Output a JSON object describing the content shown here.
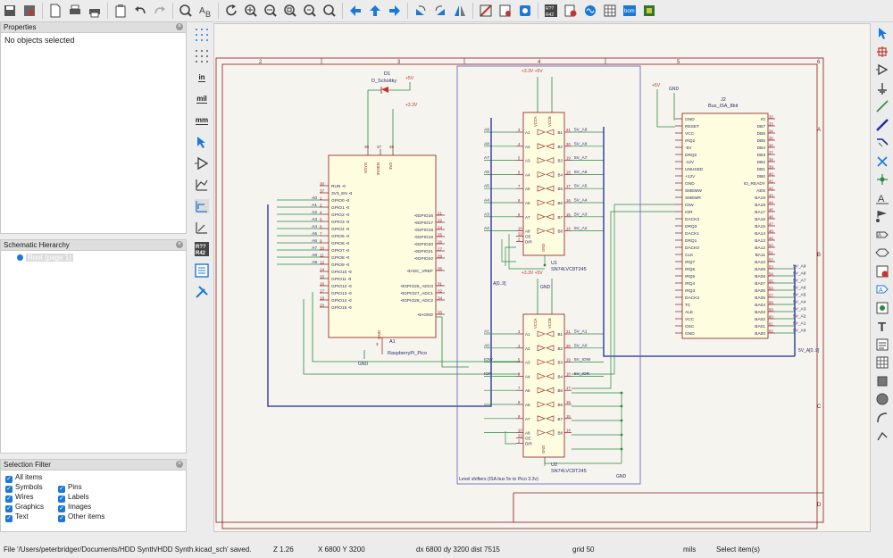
{
  "toolbar": {
    "icons": [
      "save-icon",
      "page-settings-icon",
      "new-icon",
      "print-icon",
      "plot-icon",
      "paste-icon",
      "undo-icon",
      "redo-icon",
      "find-icon",
      "find-replace-icon",
      "refresh-icon",
      "zoom-in-icon",
      "zoom-out-icon",
      "zoom-fit-icon",
      "zoom-selection-icon",
      "zoom-tool-icon",
      "navigate-back-icon",
      "navigate-up-icon",
      "navigate-forward-icon",
      "rotate-ccw-icon",
      "rotate-cw-icon",
      "mirror-icon",
      "erc-icon",
      "symbol-editor-icon",
      "symbol-browser-icon",
      "annotate-icon",
      "erc-check-icon",
      "simulator-icon",
      "field-table-icon",
      "bom-icon",
      "pcb-icon"
    ],
    "annotate_label": "R?? R42",
    "bom_label": "bom"
  },
  "properties_panel": {
    "title": "Properties",
    "empty_text": "No objects selected"
  },
  "hierarchy_panel": {
    "title": "Schematic Hierarchy",
    "root_item": "Root (page 1)"
  },
  "selection_filter": {
    "title": "Selection Filter",
    "items": [
      {
        "label": "All items",
        "checked": true
      },
      {
        "label": "Symbols",
        "checked": true
      },
      {
        "label": "Pins",
        "checked": true
      },
      {
        "label": "Wires",
        "checked": true
      },
      {
        "label": "Labels",
        "checked": true
      },
      {
        "label": "Graphics",
        "checked": true
      },
      {
        "label": "Images",
        "checked": true
      },
      {
        "label": "Text",
        "checked": true
      },
      {
        "label": "Other items",
        "checked": true
      }
    ]
  },
  "left_tools": {
    "units_in": "in",
    "units_mil": "mil",
    "units_mm": "mm",
    "annotate_label": "R?? R42"
  },
  "schematic": {
    "border_numbers": [
      "2",
      "3",
      "4",
      "5",
      "6"
    ],
    "border_letters": [
      "A",
      "B",
      "C",
      "D"
    ],
    "diode": {
      "ref": "D1",
      "value": "D_Schottky",
      "net": "+5V"
    },
    "pico": {
      "ref": "A1",
      "value": "RaspberryPi_Pico",
      "top_net": "+3.3V",
      "gnd": "GND",
      "top_pins": [
        "VSYS",
        "3V3EN",
        "3V3"
      ],
      "top_pin_nums": [
        "39",
        "37",
        "36"
      ],
      "left_pins": [
        "RUN",
        "3V3_EN",
        "GPIO0",
        "GPIO1",
        "GPIO2",
        "GPIO3",
        "GPIO4",
        "GPIO5",
        "GPIO6",
        "GPIO7",
        "GPIO8",
        "GPIO9",
        "GPIO10",
        "GPIO11",
        "GPIO12",
        "GPIO13",
        "GPIO14",
        "GPIO15"
      ],
      "left_nums": [
        "30",
        "37",
        "1",
        "2",
        "4",
        "5",
        "6",
        "7",
        "9",
        "10",
        "11",
        "12",
        "14",
        "15",
        "16",
        "17",
        "19",
        "20"
      ],
      "left_labels": [
        "",
        "",
        "A0",
        "A1",
        "A2",
        "A3",
        "A4",
        "A5",
        "A6",
        "A7",
        "A8",
        "A9",
        "",
        "",
        "",
        "",
        "",
        ""
      ],
      "right_pins": [
        "GPIO16",
        "GPIO17",
        "GPIO18",
        "GPIO19",
        "GPIO20",
        "GPIO21",
        "GPIO22",
        "ADC_VREF",
        "GPIO26_ADC0",
        "GPIO27_ADC1",
        "GPIO28_ADC2",
        "AGND"
      ],
      "right_nums": [
        "21",
        "22",
        "24",
        "25",
        "26",
        "27",
        "29",
        "35",
        "31",
        "32",
        "34",
        "33"
      ],
      "bottom_pin": "GND",
      "bottom_num": "3"
    },
    "u1": {
      "ref": "U1",
      "value": "SN74LVC8T245",
      "top_label": "+3.3V +5V",
      "top_pins": [
        "VCCA",
        "VCCB"
      ],
      "a_pins": [
        "A1",
        "A2",
        "A3",
        "A4",
        "A5",
        "A6",
        "A7",
        "A8",
        "OE",
        "DIR"
      ],
      "b_pins": [
        "B1",
        "B2",
        "B3",
        "B4",
        "B5",
        "B6",
        "B7",
        "B8"
      ],
      "left_nums": [
        "3",
        "4",
        "5",
        "6",
        "7",
        "8",
        "9",
        "10",
        "22",
        "2"
      ],
      "right_nums": [
        "21",
        "20",
        "19",
        "18",
        "17",
        "16",
        "15",
        "14"
      ],
      "in_labels": [
        "A9",
        "A8",
        "A7",
        "A6",
        "A5",
        "A4",
        "A3",
        "A2"
      ],
      "out_labels": [
        "5V_A9",
        "5V_A8",
        "5V_A7",
        "5V_A6",
        "5V_A5",
        "5V_A4",
        "5V_A3",
        "5V_A2"
      ],
      "gnd": "GND",
      "bus_label": "A[0..9]"
    },
    "u2": {
      "ref": "U2",
      "value": "SN74LVC8T245",
      "top_label": "+3.3V +5V",
      "top_pins": [
        "VCCA",
        "VCCB"
      ],
      "a_pins": [
        "A1",
        "A2",
        "A3",
        "A4",
        "A5",
        "A6",
        "A7",
        "A8",
        "OE",
        "DIR"
      ],
      "b_pins": [
        "B1",
        "B2",
        "B3",
        "B4",
        "B5",
        "B6",
        "B7",
        "B8"
      ],
      "left_nums": [
        "3",
        "4",
        "5",
        "6",
        "7",
        "8",
        "9",
        "10",
        "22",
        "2"
      ],
      "right_nums": [
        "21",
        "20",
        "19",
        "18",
        "17",
        "16",
        "15",
        "14"
      ],
      "in_labels": [
        "A1",
        "A0",
        "IOW",
        "IOR",
        "",
        "",
        "",
        ""
      ],
      "out_labels": [
        "5V_A1",
        "5V_A0",
        "5V_IOW",
        "5V_IOR",
        "",
        "",
        "",
        ""
      ],
      "gnd": "GND",
      "gnd_top": "GND"
    },
    "level_shift_caption": "Level shifters (ISA bus 5v to Pico 3.3v)",
    "j2": {
      "ref": "J2",
      "value": "Bus_ISA_8bit",
      "top_net": "+5V",
      "gnd_net": "GND",
      "left_pins": [
        "GND",
        "RESET",
        "VCC",
        "IRQ2",
        "-5V",
        "DRQ2",
        "-12V",
        "UNUSED",
        "+12V",
        "GND",
        "SMEMW",
        "SMEMR",
        "IOW",
        "IOR",
        "DACK3",
        "DRQ3",
        "DACK1",
        "DRQ1",
        "DACK0",
        "CLK",
        "IRQ7",
        "IRQ6",
        "IRQ5",
        "IRQ4",
        "IRQ3",
        "DACK2",
        "TC",
        "ALE",
        "VCC",
        "OSC",
        "GND"
      ],
      "right_pins": [
        "IO",
        "DB7",
        "DB6",
        "DB5",
        "DB4",
        "DB3",
        "DB2",
        "DB1",
        "DB0",
        "IO_READY",
        "AEN",
        "BA19",
        "BA18",
        "BA17",
        "BA16",
        "BA15",
        "BA14",
        "BA13",
        "BA12",
        "BA11",
        "BA10",
        "BA09",
        "BA08",
        "BA07",
        "BA06",
        "BA05",
        "BA04",
        "BA03",
        "BA02",
        "BA01",
        "BA00"
      ],
      "right_nums": [
        "32",
        "33",
        "34",
        "35",
        "36",
        "37",
        "38",
        "39",
        "40",
        "41",
        "42",
        "43",
        "44",
        "45",
        "46",
        "47",
        "48",
        "49",
        "50",
        "51",
        "52",
        "53",
        "54",
        "55",
        "56",
        "57",
        "58",
        "59",
        "60",
        "61",
        "62"
      ],
      "out_labels": [
        "5V_A9",
        "5V_A8",
        "5V_A7",
        "5V_A6",
        "5V_A5",
        "5V_A4",
        "5V_A3",
        "5V_A2",
        "5V_A1",
        "5V_A0"
      ],
      "bus_label": "5V_A[0..9]"
    }
  },
  "status": {
    "file_text": "File '/Users/peterbridger/Documents/HDD Synth/HDD Synth.kicad_sch' saved.",
    "zoom": "Z 1.26",
    "xy": "X 6800  Y 3200",
    "dxdy": "dx 6800  dy 3200  dist 7515",
    "grid": "grid 50",
    "units": "mils",
    "mode": "Select item(s)"
  },
  "colors": {
    "wire": "#2b8a3e",
    "bus": "#1f2a9a",
    "part_fill": "#fffde0",
    "part_line": "#8b1a1a",
    "pin": "#8b1a1a",
    "border": "#8b1a1a",
    "power": "#c0392b",
    "label": "#2a2a6a",
    "accent": "#1c78d6"
  }
}
